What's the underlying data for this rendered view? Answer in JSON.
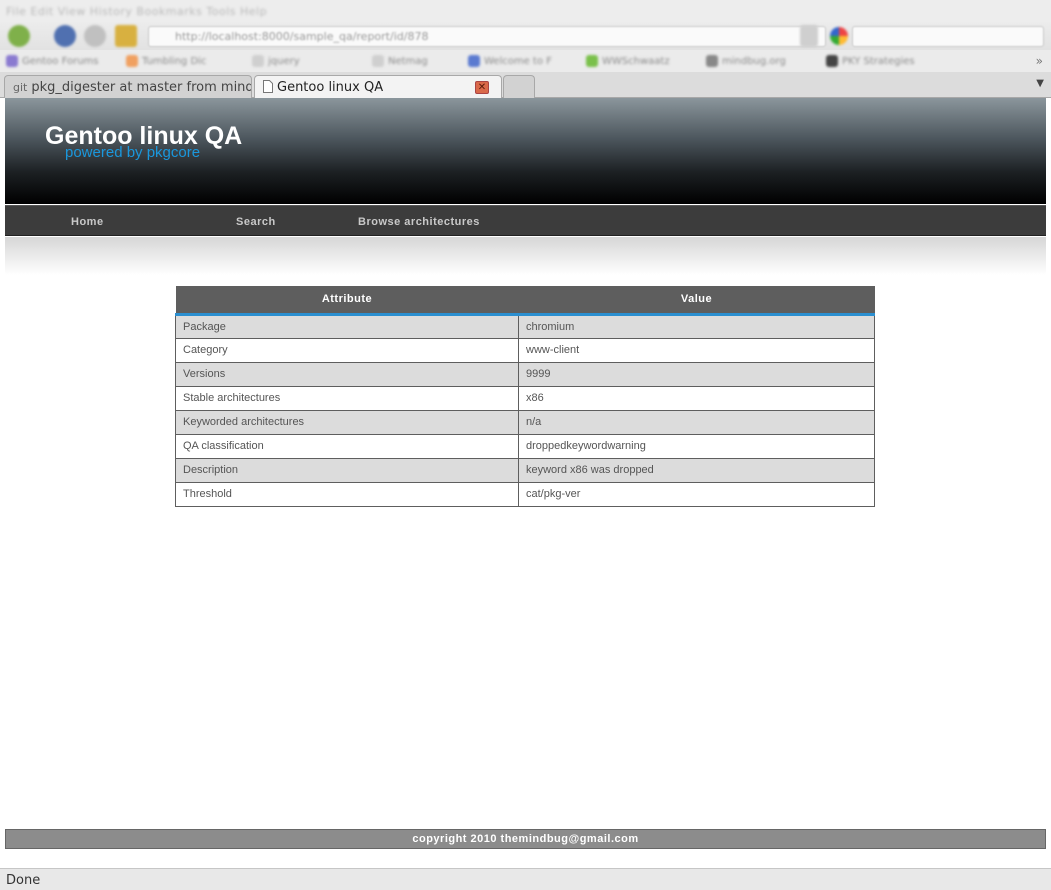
{
  "browser": {
    "menu_text": "File Edit View History Bookmarks Tools Help",
    "url": "http://localhost:8000/sample_qa/report/id/878",
    "bookmarks": [
      {
        "label": "Gentoo Forums",
        "color": "#8a7ad0"
      },
      {
        "label": "Tumbling Dic",
        "color": "#f0a060"
      },
      {
        "label": "jquery",
        "color": "#cfcfcf"
      },
      {
        "label": "Netmag",
        "color": "#cfcfcf"
      },
      {
        "label": "Welcome to F",
        "color": "#5a7ad0"
      },
      {
        "label": "WWSchwaatz",
        "color": "#7ac04a"
      },
      {
        "label": "mindbug.org",
        "color": "#888888"
      },
      {
        "label": "PKY Strategies",
        "color": "#444444"
      }
    ],
    "tabs": [
      {
        "icon": "git",
        "label": "pkg_digester at master from mindb..."
      },
      {
        "icon": "",
        "label": "Gentoo linux QA"
      }
    ],
    "status": "Done"
  },
  "site": {
    "title": "Gentoo linux QA",
    "subtitle": "powered by pkgcore",
    "nav": [
      "Home",
      "Search",
      "Browse architectures"
    ],
    "footer": "copyright 2010 themindbug@gmail.com"
  },
  "table": {
    "headers": [
      "Attribute",
      "Value"
    ],
    "rows": [
      [
        "Package",
        "chromium"
      ],
      [
        "Category",
        "www-client"
      ],
      [
        "Versions",
        "9999"
      ],
      [
        "Stable architectures",
        "x86"
      ],
      [
        "Keyworded architectures",
        "n/a"
      ],
      [
        "QA classification",
        "droppedkeywordwarning"
      ],
      [
        "Description",
        "keyword x86 was dropped"
      ],
      [
        "Threshold",
        "cat/pkg-ver"
      ]
    ]
  }
}
